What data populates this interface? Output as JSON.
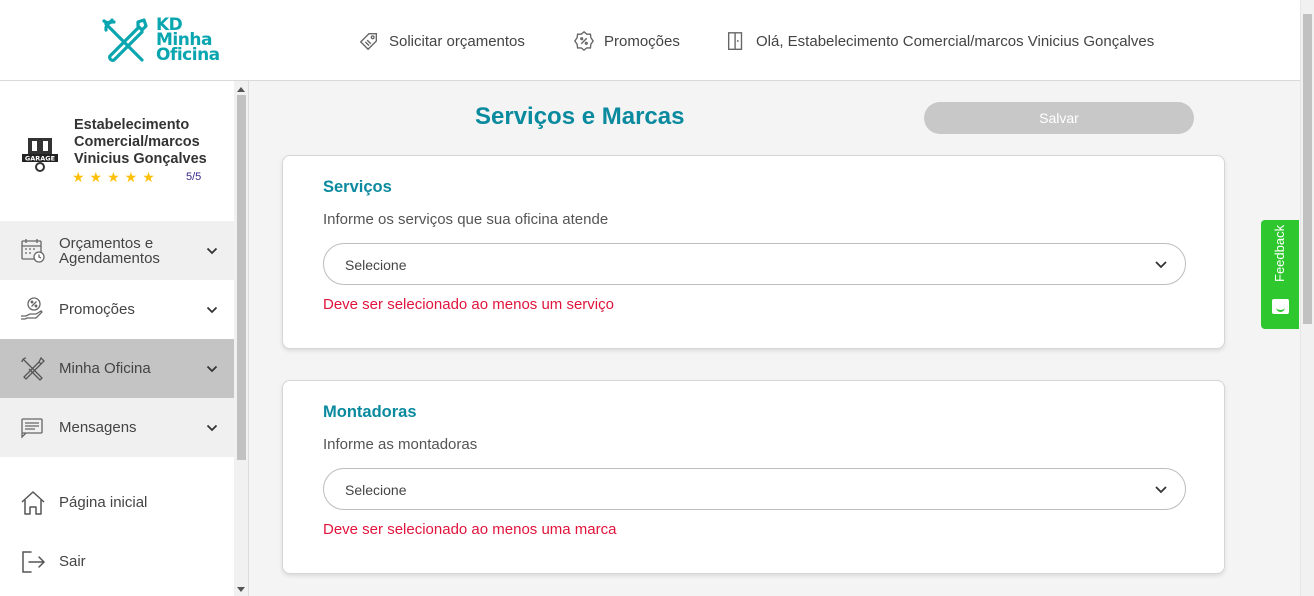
{
  "header": {
    "logo_lines": [
      "KD",
      "Minha",
      "Oficina"
    ],
    "nav": [
      {
        "label": "Solicitar orçamentos",
        "icon": "tag-icon"
      },
      {
        "label": "Promoções",
        "icon": "percent-badge-icon"
      },
      {
        "label": "Olá, Estabelecimento Comercial/marcos Vinicius Gonçalves",
        "icon": "door-icon"
      }
    ]
  },
  "sidebar": {
    "profile": {
      "name": "Estabelecimento Comercial/marcos Vinicius Gonçalves",
      "stars": "★★★★★",
      "rating_value": 5,
      "rating_label": "5/5",
      "avatar_text": "GARAGE"
    },
    "menu": [
      {
        "label": "Orçamentos e Agendamentos",
        "icon": "calendar-clock-icon",
        "expandable": true
      },
      {
        "label": "Promoções",
        "icon": "hand-percent-icon",
        "expandable": true
      },
      {
        "label": "Minha Oficina",
        "icon": "wrench-screwdriver-icon",
        "expandable": true,
        "active": true
      },
      {
        "label": "Mensagens",
        "icon": "message-icon",
        "expandable": true
      }
    ],
    "bottom": [
      {
        "label": "Página inicial",
        "icon": "home-icon"
      },
      {
        "label": "Sair",
        "icon": "logout-icon"
      }
    ]
  },
  "main": {
    "title": "Serviços e Marcas",
    "save_label": "Salvar",
    "sections": [
      {
        "heading": "Serviços",
        "description": "Informe os serviços que sua oficina atende",
        "select_value": "Selecione",
        "error": "Deve ser selecionado ao menos um serviço"
      },
      {
        "heading": "Montadoras",
        "description": "Informe as montadoras",
        "select_value": "Selecione",
        "error": "Deve ser selecionado ao menos uma marca"
      }
    ]
  },
  "feedback": {
    "label": "Feedback"
  },
  "colors": {
    "brand": "#0aa6b0",
    "title": "#0a8a9e",
    "error": "#e0143c",
    "star": "#ffc107",
    "feedback": "#2ec82e",
    "save_disabled": "#c8c8c8"
  }
}
